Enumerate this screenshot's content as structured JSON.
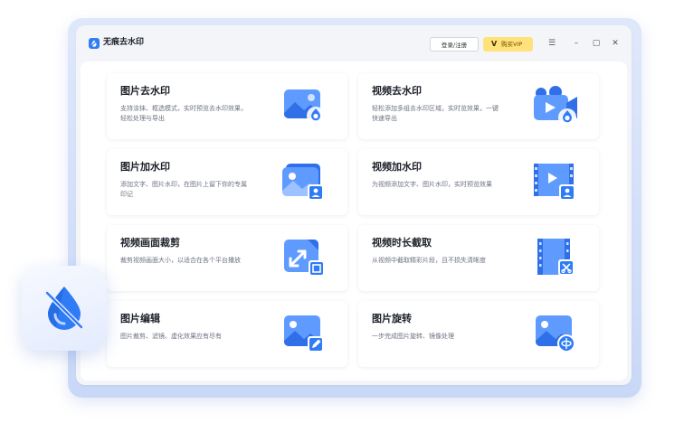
{
  "app": {
    "title": "无痕去水印"
  },
  "header": {
    "login_label": "登录/注册",
    "vip_label": "购买VIP",
    "vip_icon_glyph": "V"
  },
  "window_controls": {
    "menu": "☰",
    "minimize": "–",
    "maximize": "▢",
    "close": "✕"
  },
  "colors": {
    "accent": "#2f7cf6",
    "vip_bg": "#ffe37a"
  },
  "features": [
    {
      "title": "图片去水印",
      "desc": "支持涂抹、框选模式，实时预览去水印效果，轻松处理与导出",
      "icon": "image-drop-icon"
    },
    {
      "title": "视频去水印",
      "desc": "轻松添加多组去水印区域，实时览效果，一键快速导出",
      "icon": "video-drop-icon"
    },
    {
      "title": "图片加水印",
      "desc": "添加文字、图片水印，在图片上留下你的专属印记",
      "icon": "image-portrait-icon"
    },
    {
      "title": "视频加水印",
      "desc": "为视频添加文字、图片水印，实时预览效果",
      "icon": "video-portrait-icon"
    },
    {
      "title": "视频画面裁剪",
      "desc": "裁剪视频画面大小，以适合在各个平台播放",
      "icon": "crop-icon"
    },
    {
      "title": "视频时长截取",
      "desc": "从视频中截取精彩片段，且不损失清晰度",
      "icon": "film-cut-icon"
    },
    {
      "title": "图片编辑",
      "desc": "图片裁剪、滤镜、虚化效果应有尽有",
      "icon": "image-edit-icon"
    },
    {
      "title": "图片旋转",
      "desc": "一步完成图片旋转、镜像处理",
      "icon": "image-rotate-icon"
    }
  ]
}
